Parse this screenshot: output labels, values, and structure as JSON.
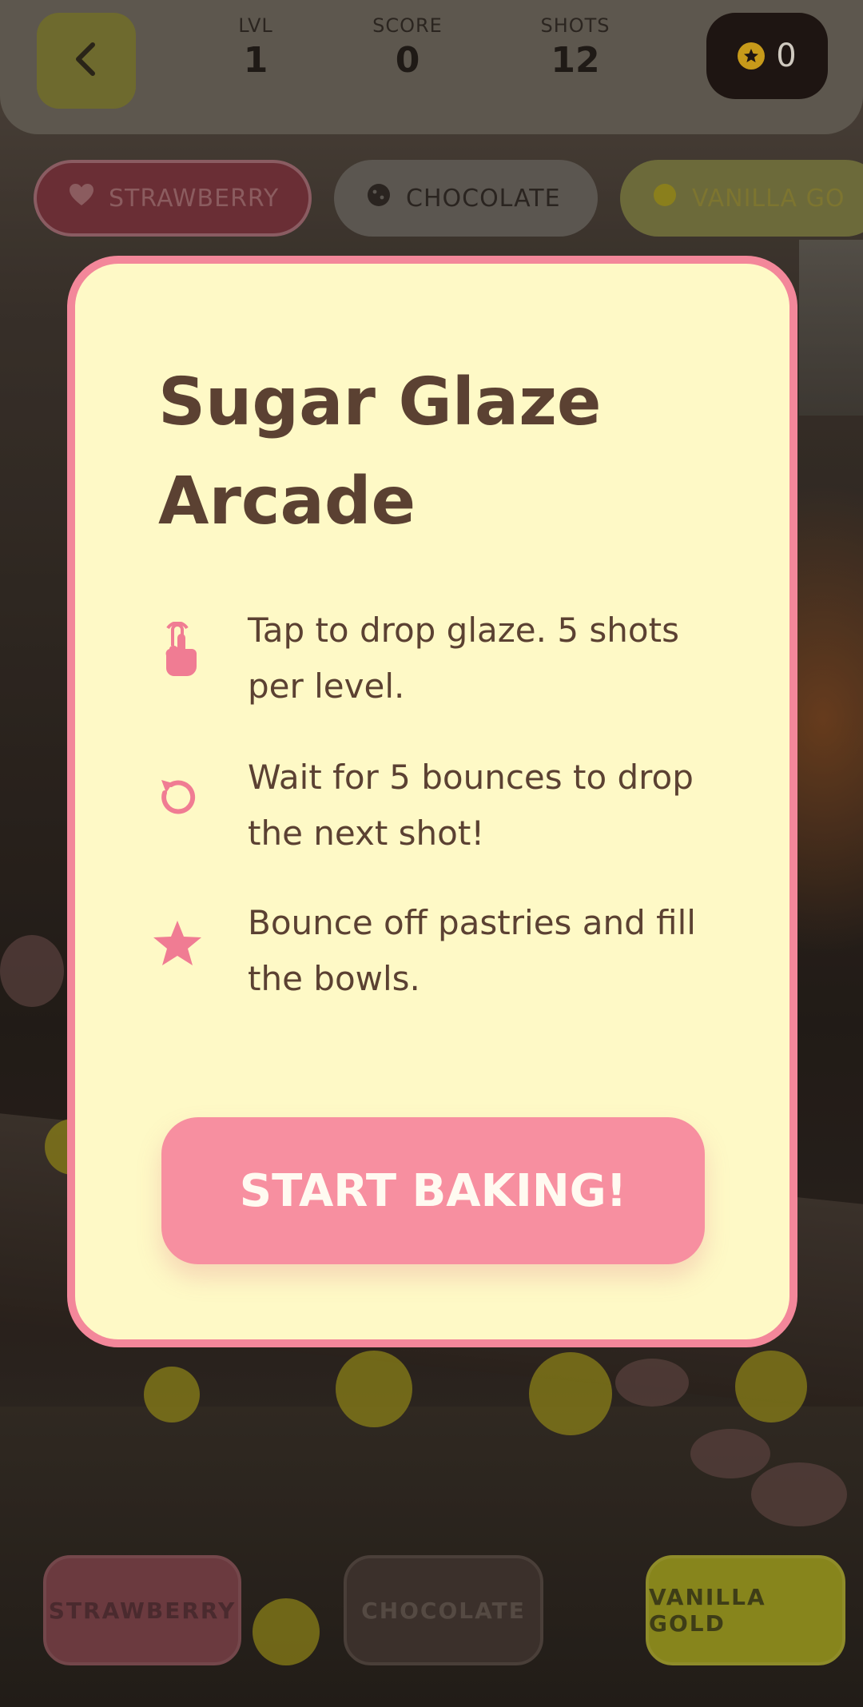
{
  "hud": {
    "level_label": "LVL",
    "level_value": "1",
    "score_label": "SCORE",
    "score_value": "0",
    "shots_label": "SHOTS",
    "shots_value": "12",
    "coins_value": "0",
    "back_icon": "chevron-left-icon",
    "coin_icon": "star-coin-icon"
  },
  "top_chips": [
    {
      "label": "STRAWBERRY",
      "icon": "heart-icon"
    },
    {
      "label": "CHOCOLATE",
      "icon": "cookie-icon"
    },
    {
      "label": "VANILLA GO",
      "icon": "circle-icon"
    }
  ],
  "modal": {
    "title_line1": "Sugar Glaze",
    "title_line2": "Arcade",
    "rules": [
      {
        "icon": "tap-hand-icon",
        "text": "Tap to drop glaze. 5 shots per level."
      },
      {
        "icon": "rotate-icon",
        "text": "Wait for 5 bounces to drop the next shot!"
      },
      {
        "icon": "star-icon",
        "text": "Bounce off pastries and fill the bowls."
      }
    ],
    "start_label": "START BAKING!"
  },
  "bottom_buttons": [
    {
      "label": "STRAWBERRY"
    },
    {
      "label": "CHOCOLATE"
    },
    {
      "label": "VANILLA GOLD"
    }
  ],
  "colors": {
    "modal_bg": "#fef9c6",
    "modal_border": "#f3879a",
    "accent_pink": "#f78fa0",
    "text_brown": "#5b4132"
  }
}
